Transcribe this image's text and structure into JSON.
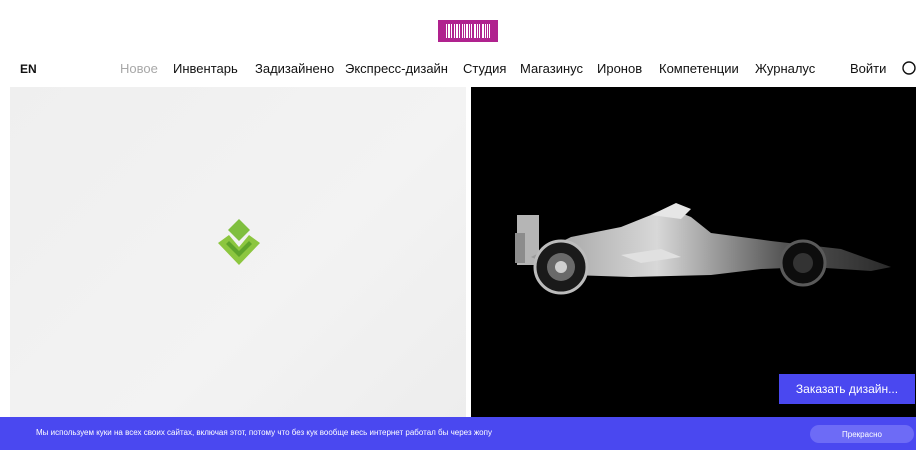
{
  "header": {
    "logo_icon": "barcode-logo",
    "lang": "EN",
    "nav": [
      "Новое",
      "Инвентарь",
      "Задизайнено",
      "Экспресс-дизайн",
      "Студия",
      "Магазинус",
      "Иронов",
      "Компетенции",
      "Журналус"
    ],
    "login": "Войти",
    "search_icon": "search-icon"
  },
  "hero": {
    "left_icon": "green-diamond-logo",
    "right_image": "formula-one-car",
    "order_button": "Заказать дизайн..."
  },
  "cookie": {
    "text": "Мы используем куки на всех своих сайтах, включая этот, потому что без кук вообще весь интернет работал бы через жопу",
    "accept_button": "Прекрасно"
  },
  "colors": {
    "logo": "#b0228e",
    "accent": "#4a48f0",
    "green": "#8cc63f"
  }
}
